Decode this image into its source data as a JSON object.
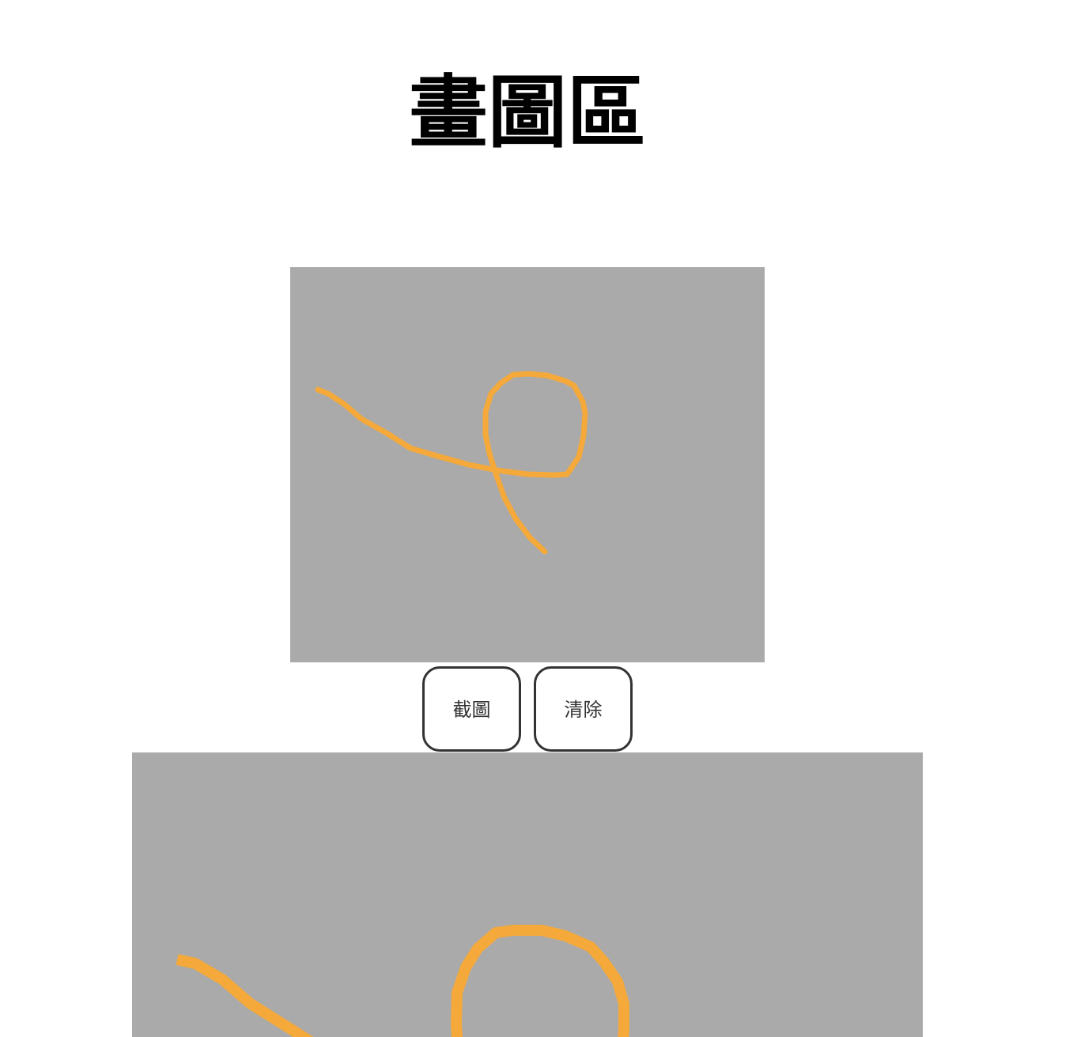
{
  "header": {
    "title": "畫圖區"
  },
  "drawing_area": {
    "background_color": "#aaaaaa",
    "stroke_color": "#f4a93a"
  },
  "toolbar": {
    "capture_label": "截圖",
    "clear_label": "清除"
  },
  "preview": {
    "background_color": "#aaaaaa",
    "stroke_color": "#f4a93a"
  }
}
